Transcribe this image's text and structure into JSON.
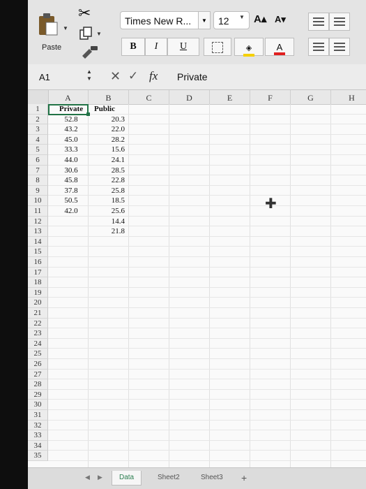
{
  "ribbon": {
    "paste_label": "Paste",
    "font_name": "Times New R...",
    "font_size": "12",
    "grow_font": "A▴",
    "shrink_font": "A▾",
    "bold": "B",
    "italic": "I",
    "underline": "U",
    "fill_color": "#f5d000",
    "font_color": "#e02020",
    "icons": [
      "paste-icon",
      "cut-icon",
      "copy-icon",
      "format-painter-icon",
      "borders-icon",
      "fill-color-icon",
      "font-color-icon",
      "align-icon"
    ]
  },
  "formula_bar": {
    "name_box": "A1",
    "fx": "fx",
    "content": "Private"
  },
  "columns": [
    "A",
    "B",
    "C",
    "D",
    "E",
    "F",
    "G",
    "H"
  ],
  "rows": [
    "1",
    "2",
    "3",
    "4",
    "5",
    "6",
    "7",
    "8",
    "9",
    "10",
    "11",
    "12",
    "13",
    "14",
    "15",
    "16",
    "17",
    "18",
    "19",
    "20",
    "21",
    "22",
    "23",
    "24",
    "25",
    "26",
    "27",
    "28",
    "29",
    "30",
    "31",
    "32",
    "33",
    "34",
    "35"
  ],
  "data": {
    "headers": [
      "Private",
      "Public"
    ],
    "private": [
      "52.8",
      "43.2",
      "45.0",
      "33.3",
      "44.0",
      "30.6",
      "45.8",
      "37.8",
      "50.5",
      "42.0"
    ],
    "public": [
      "20.3",
      "22.0",
      "28.2",
      "15.6",
      "24.1",
      "28.5",
      "22.8",
      "25.8",
      "18.5",
      "25.6",
      "14.4",
      "21.8"
    ]
  },
  "sheet_tabs": [
    "Data",
    "Sheet2",
    "Sheet3"
  ],
  "add_sheet": "+"
}
